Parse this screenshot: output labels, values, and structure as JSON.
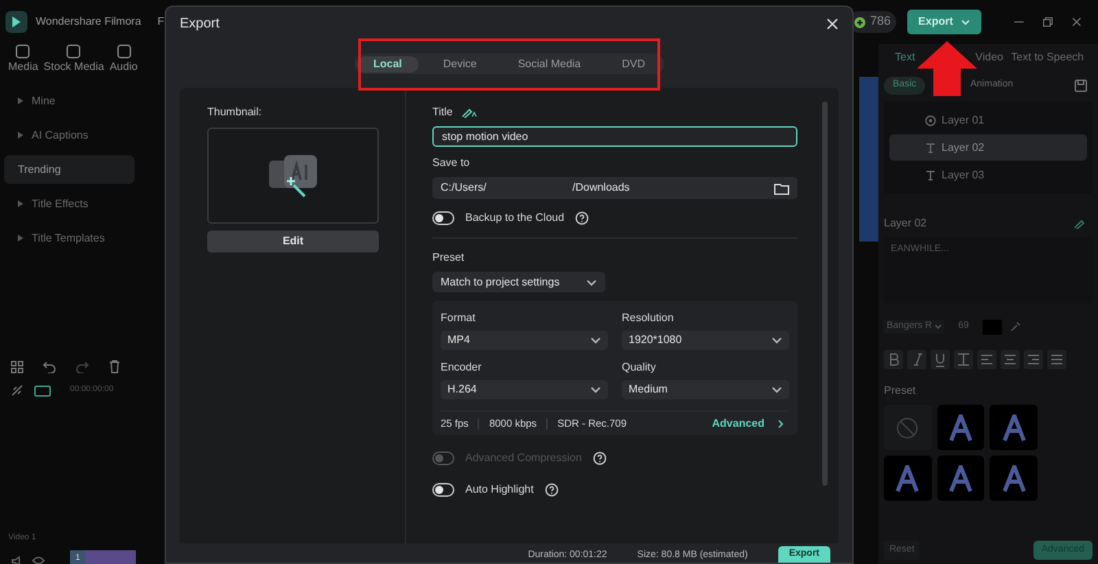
{
  "app": {
    "title": "Wondershare Filmora",
    "menu_partial": "F",
    "credits": "786",
    "export_button": "Export",
    "media_tabs": [
      {
        "label": "Media",
        "selected": false
      },
      {
        "label": "Stock Media",
        "selected": false
      },
      {
        "label": "Audio",
        "selected": false
      }
    ],
    "sidebar": [
      {
        "label": "Mine",
        "selected": false
      },
      {
        "label": "AI Captions",
        "selected": false
      },
      {
        "label": "Trending",
        "selected": true
      },
      {
        "label": "Title Effects",
        "selected": false
      },
      {
        "label": "Title Templates",
        "selected": false
      }
    ],
    "timeline": {
      "timecode": "00:00:00:00",
      "track_label": "Video 1",
      "clip_number": "1"
    },
    "right_panel": {
      "tabs": [
        {
          "label": "Text",
          "selected": true
        },
        {
          "label": "Video",
          "selected": false
        },
        {
          "label": "Text to Speech",
          "selected": false
        }
      ],
      "subtabs": [
        {
          "label": "Basic",
          "selected": true
        },
        {
          "label": "Animation",
          "selected": false
        }
      ],
      "layers": [
        {
          "label": "Layer 01",
          "kind": "group",
          "selected": false
        },
        {
          "label": "Layer 02",
          "kind": "text",
          "selected": true
        },
        {
          "label": "Layer 03",
          "kind": "text",
          "selected": false
        }
      ],
      "layer_title": "Layer 02",
      "text_value": "EANWHILE...",
      "font": "Bangers R",
      "size": "69",
      "preset_label": "Preset",
      "reset_button": "Reset",
      "advanced_button": "Advanced"
    }
  },
  "export_dialog": {
    "title": "Export",
    "tabs": [
      {
        "label": "Local",
        "selected": true
      },
      {
        "label": "Device",
        "selected": false
      },
      {
        "label": "Social Media",
        "selected": false
      },
      {
        "label": "DVD",
        "selected": false
      }
    ],
    "thumbnail_label": "Thumbnail:",
    "edit_button": "Edit",
    "title_label": "Title",
    "title_value": "stop motion video",
    "save_to_label": "Save to",
    "save_path_start": "C:/Users/",
    "save_path_end": "/Downloads",
    "backup": {
      "label": "Backup to the Cloud",
      "on": false
    },
    "preset_label": "Preset",
    "preset_value": "Match to project settings",
    "settings": [
      {
        "label": "Format",
        "value": "MP4"
      },
      {
        "label": "Resolution",
        "value": "1920*1080"
      },
      {
        "label": "Encoder",
        "value": "H.264"
      },
      {
        "label": "Quality",
        "value": "Medium"
      }
    ],
    "info": [
      "25 fps",
      "8000 kbps",
      "SDR - Rec.709"
    ],
    "advanced_link": "Advanced",
    "options": [
      {
        "label": "Advanced Compression",
        "on": false,
        "disabled": true
      },
      {
        "label": "Auto Highlight",
        "on": false,
        "disabled": false
      }
    ],
    "duration": "Duration: 00:01:22",
    "size": "Size: 80.8 MB (estimated)",
    "export_button": "Export"
  }
}
